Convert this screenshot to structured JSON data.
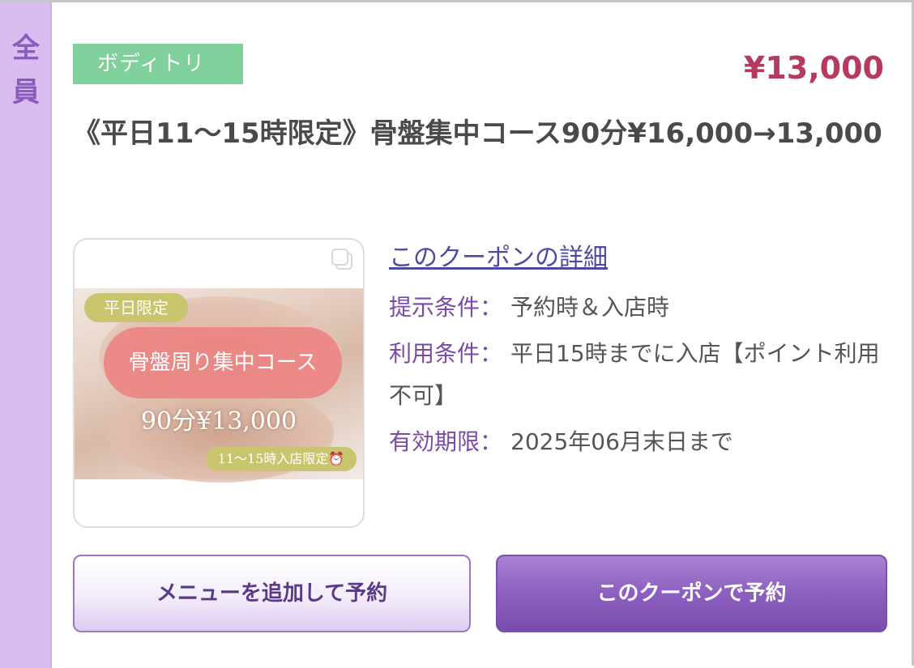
{
  "side_tab": {
    "chars": [
      "全",
      "員"
    ]
  },
  "coupon": {
    "category": "ボディトリ",
    "price": "¥13,000",
    "title": "《平日11〜15時限定》骨盤集中コース90分¥16,000→13,000",
    "image": {
      "badge_weekday": "平日限定",
      "course_text": "骨盤周り集中コース",
      "price_text": "90分¥13,000",
      "time_badge": "11〜15時入店限定⏰"
    },
    "details_link": "このクーポンの詳細",
    "conditions": [
      {
        "key": "提示条件",
        "sep": "：",
        "value": "予約時＆入店時"
      },
      {
        "key": "利用条件",
        "sep": "：",
        "value": "平日15時までに入店【ポイント利用不可】"
      },
      {
        "key": "有効期限",
        "sep": "：",
        "value": "2025年06月末日まで"
      }
    ]
  },
  "buttons": {
    "add_menu": "メニューを追加して予約",
    "book_coupon": "このクーポンで予約"
  },
  "colors": {
    "side_tab": "#d9bdf0",
    "category_tag": "#7fd09a",
    "price": "#b53a5e",
    "accent_purple": "#8c5fc0"
  }
}
